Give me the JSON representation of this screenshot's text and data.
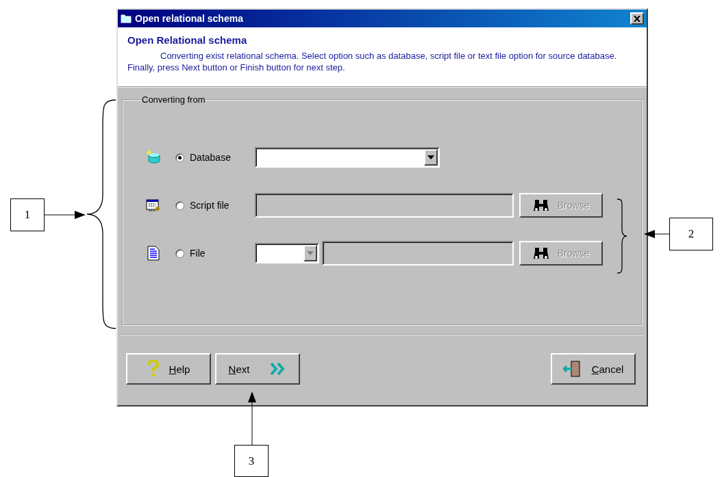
{
  "window": {
    "title": "Open relational schema"
  },
  "header": {
    "title": "Open Relational schema",
    "description": "Converting exist relational schema. Select option such as database, script file or text file option for source database. Finally, press Next button or Finish button for next step."
  },
  "group": {
    "title": "Converting from",
    "options": [
      {
        "kind": "combo",
        "label": "Database",
        "selected": true
      },
      {
        "kind": "path",
        "label": "Script file",
        "selected": false,
        "browse": {
          "label": "Browse",
          "disabled": true
        }
      },
      {
        "kind": "combo_path",
        "label": "File",
        "selected": false,
        "browse": {
          "label": "Browse",
          "disabled": true
        }
      }
    ]
  },
  "buttons": [
    {
      "kind": "help",
      "label": "Help"
    },
    {
      "kind": "next",
      "label": "Next"
    },
    {
      "kind": "cancel",
      "label": "Cancel"
    }
  ],
  "callouts": [
    "1",
    "2",
    "3"
  ]
}
